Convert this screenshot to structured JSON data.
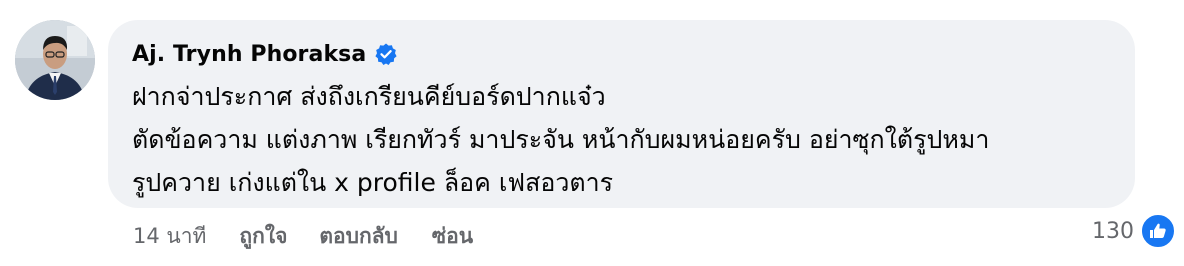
{
  "comment": {
    "author": "Aj. Trynh Phoraksa",
    "verified": true,
    "lines": [
      "ฝากจ่าประกาศ ส่งถึงเกรียนคีย์บอร์ดปากแจ๋ว",
      "ตัดข้อความ แต่งภาพ เรียกทัวร์ มาประจัน หน้ากับผมหน่อยครับ อย่าซุกใต้รูปหมา",
      "รูปควาย เก่งแต่ใน x profile ล็อค เฟสอวตาร"
    ]
  },
  "actions": {
    "timestamp": "14 นาที",
    "like": "ถูกใจ",
    "reply": "ตอบกลับ",
    "hide": "ซ่อน"
  },
  "reactions": {
    "count": "130",
    "icon": "thumbs-up-icon",
    "color": "#1877f2"
  },
  "colors": {
    "bubble": "#f0f2f5",
    "text": "#050505",
    "secondary_text": "#65676b",
    "verified_badge": "#1877f2"
  }
}
